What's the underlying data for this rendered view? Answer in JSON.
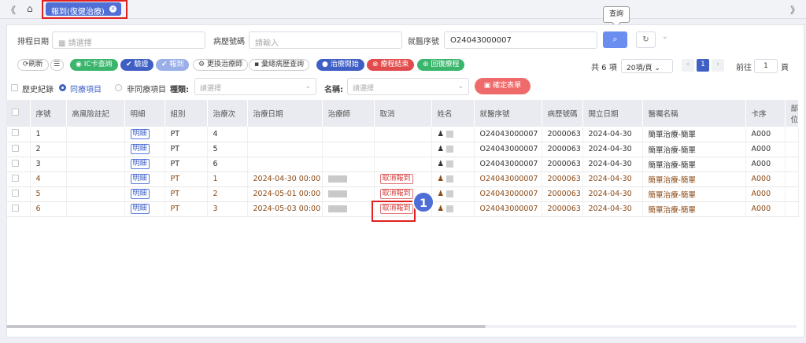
{
  "topbar": {
    "nav_left": "《",
    "nav_right": "》",
    "home_icon": "home-icon",
    "tab_label": "報到(復健治療)",
    "tab_close": "×"
  },
  "tooltip": "查詢",
  "filters": {
    "schedule_date_label": "排程日期",
    "schedule_date_placeholder": "請選擇",
    "chart_no_label": "病歷號碼",
    "chart_no_placeholder": "請輸入",
    "visit_no_label": "就醫序號",
    "visit_no_value": "O24043000007"
  },
  "toolbar": {
    "refresh": "⟳刷新",
    "list_icon": "☰",
    "ic_card": "IC卡查詢",
    "verify": "驗證",
    "checkin": "報到",
    "change_therapist": "更換治療師",
    "emr_query": "彙總病歷查詢",
    "therapy_start": "治療開始",
    "therapy_end": "療程結束",
    "restore": "回復療程"
  },
  "pagination": {
    "total": "共 6 項",
    "page_size": "20項/頁",
    "prev": "‹",
    "current": "1",
    "next": "›",
    "goto_label": "前往",
    "goto_value": "1",
    "page_unit": "頁"
  },
  "options": {
    "history": "歷史紀錄",
    "same_item": "同療項目",
    "diff_item": "非同療項目",
    "kind_label": "種類:",
    "kind_placeholder": "請選擇",
    "name_label": "名稱:",
    "name_placeholder": "請選擇",
    "confirm_btn": "確定表單"
  },
  "table": {
    "headers": [
      "序號",
      "高風險註記",
      "明細",
      "組別",
      "治療次",
      "治療日期",
      "治療師",
      "取消",
      "姓名",
      "就醫序號",
      "病歷號碼",
      "開立日期",
      "醫囑名稱",
      "卡序",
      "部位"
    ],
    "rows": [
      {
        "no": "1",
        "detail": "明細",
        "group": "PT",
        "times": "4",
        "date": "",
        "cancel": "",
        "visit": "O24043000007",
        "chart": "2000063",
        "issued": "2024-04-30",
        "order": "簡單治療-簡單",
        "card": "A000"
      },
      {
        "no": "2",
        "detail": "明細",
        "group": "PT",
        "times": "5",
        "date": "",
        "cancel": "",
        "visit": "O24043000007",
        "chart": "2000063",
        "issued": "2024-04-30",
        "order": "簡單治療-簡單",
        "card": "A000"
      },
      {
        "no": "3",
        "detail": "明細",
        "group": "PT",
        "times": "6",
        "date": "",
        "cancel": "",
        "visit": "O24043000007",
        "chart": "2000063",
        "issued": "2024-04-30",
        "order": "簡單治療-簡單",
        "card": "A000"
      },
      {
        "no": "4",
        "detail": "明細",
        "group": "PT",
        "times": "1",
        "date": "2024-04-30 00:00",
        "cancel": "取消報到",
        "visit": "O24043000007",
        "chart": "2000063",
        "issued": "2024-04-30",
        "order": "簡單治療-簡單",
        "card": "A000"
      },
      {
        "no": "5",
        "detail": "明細",
        "group": "PT",
        "times": "2",
        "date": "2024-05-01 00:00",
        "cancel": "取消報到",
        "visit": "O24043000007",
        "chart": "2000063",
        "issued": "2024-04-30",
        "order": "簡單治療-簡單",
        "card": "A000"
      },
      {
        "no": "6",
        "detail": "明細",
        "group": "PT",
        "times": "3",
        "date": "2024-05-03 00:00",
        "cancel": "取消報到",
        "visit": "O24043000007",
        "chart": "2000063",
        "issued": "2024-04-30",
        "order": "簡單治療-簡單",
        "card": "A000"
      }
    ]
  },
  "callout": "1"
}
